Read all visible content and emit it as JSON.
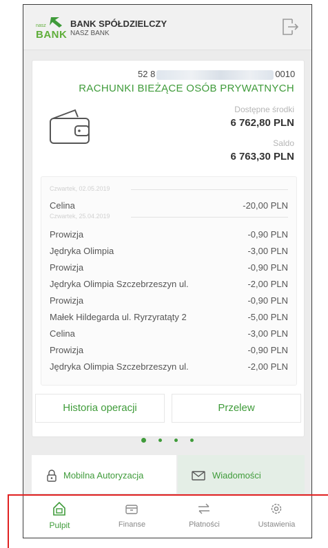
{
  "header": {
    "logo_small": "nasz",
    "logo_word": "BANK",
    "bank_name": "BANK SPÓŁDZIELCZY",
    "bank_sub": "NASZ BANK"
  },
  "account": {
    "number_prefix": "52 8",
    "number_suffix": "0010",
    "type": "RACHUNKI BIEŻĄCE OSÓB PRYWATNYCH",
    "available_label": "Dostępne środki",
    "available_value": "6 762,80 PLN",
    "balance_label": "Saldo",
    "balance_value": "6 763,30 PLN"
  },
  "transactions": {
    "date1": "Czwartek, 02.05.2019",
    "date2": "Czwartek, 25.04.2019",
    "rows": [
      {
        "desc": "Celina",
        "amount": "-20,00 PLN"
      },
      {
        "desc": "Prowizja",
        "amount": "-0,90 PLN"
      },
      {
        "desc": "Jędryka Olimpia",
        "amount": "-3,00 PLN"
      },
      {
        "desc": "Prowizja",
        "amount": "-0,90 PLN"
      },
      {
        "desc": "Jędryka Olimpia  Szczebrzeszyn ul.",
        "amount": "-2,00 PLN"
      },
      {
        "desc": "Prowizja",
        "amount": "-0,90 PLN"
      },
      {
        "desc": "Małek Hildegarda  ul. Ryrzyratąty 2",
        "amount": "-5,00 PLN"
      },
      {
        "desc": "Celina",
        "amount": "-3,00 PLN"
      },
      {
        "desc": "Prowizja",
        "amount": "-0,90 PLN"
      },
      {
        "desc": "Jędryka Olimpia  Szczebrzeszyn ul.",
        "amount": "-2,00 PLN"
      }
    ]
  },
  "actions": {
    "history_label": "Historia operacji",
    "transfer_label": "Przelew"
  },
  "shortcuts": {
    "auth_label": "Mobilna Autoryzacja",
    "messages_label": "Wiadomości"
  },
  "nav": {
    "items": [
      {
        "label": "Pulpit",
        "icon": "home-icon"
      },
      {
        "label": "Finanse",
        "icon": "wallet-icon"
      },
      {
        "label": "Płatności",
        "icon": "transfer-icon"
      },
      {
        "label": "Ustawienia",
        "icon": "gear-icon"
      }
    ],
    "active_index": 0
  },
  "colors": {
    "brand_green": "#3f9b3a",
    "logo_green": "#5fae3a",
    "highlight_frame": "#e02020"
  }
}
